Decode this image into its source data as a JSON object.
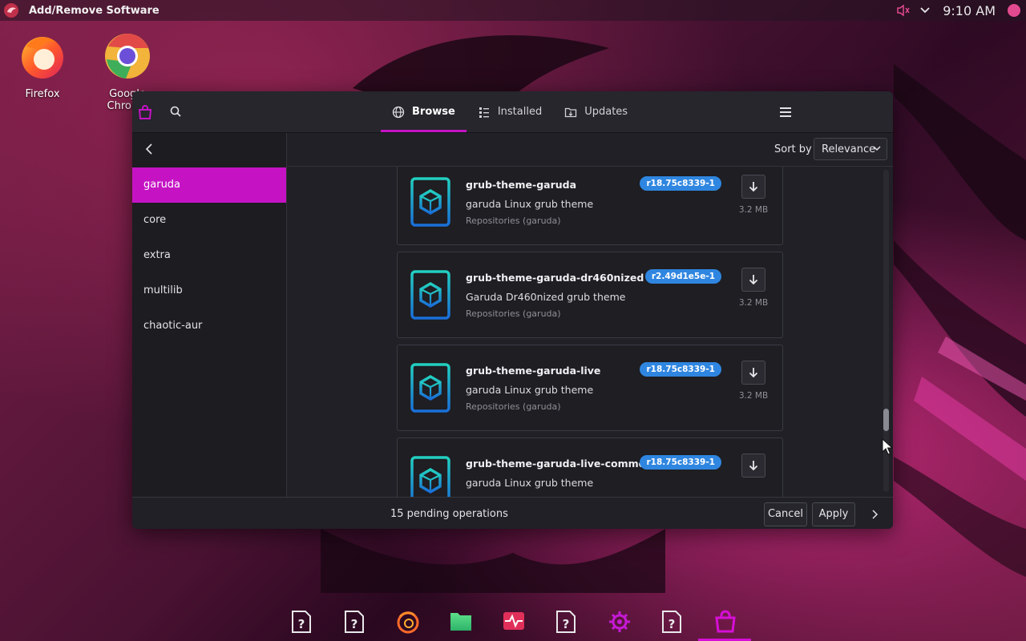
{
  "topbar": {
    "app_title": "Add/Remove Software",
    "clock": "9:10 AM",
    "icons": [
      "garuda-logo-icon",
      "speaker-muted-icon",
      "chevron-down-icon",
      "notification-dot-icon"
    ]
  },
  "desktop": {
    "icons": [
      {
        "label": "Firefox",
        "icon": "firefox-icon"
      },
      {
        "label": "Google Chrome",
        "icon": "chrome-icon"
      }
    ]
  },
  "window": {
    "tabs": [
      {
        "label": "Browse",
        "icon": "globe-icon",
        "active": true
      },
      {
        "label": "Installed",
        "icon": "list-icon",
        "active": false
      },
      {
        "label": "Updates",
        "icon": "folder-update-icon",
        "active": false
      }
    ],
    "sidebar": {
      "items": [
        {
          "label": "garuda",
          "active": true
        },
        {
          "label": "core",
          "active": false
        },
        {
          "label": "extra",
          "active": false
        },
        {
          "label": "multilib",
          "active": false
        },
        {
          "label": "chaotic-aur",
          "active": false
        }
      ]
    },
    "sort": {
      "label": "Sort by",
      "value": "Relevance"
    },
    "packages": [
      {
        "name": "grub-theme-garuda",
        "version": "r18.75c8339-1",
        "description": "garuda Linux grub theme",
        "repo": "Repositories (garuda)",
        "size": "3.2 MB"
      },
      {
        "name": "grub-theme-garuda-dr460nized",
        "version": "r2.49d1e5e-1",
        "description": "Garuda Dr460nized grub theme",
        "repo": "Repositories (garuda)",
        "size": "3.2 MB"
      },
      {
        "name": "grub-theme-garuda-live",
        "version": "r18.75c8339-1",
        "description": "garuda Linux grub theme",
        "repo": "Repositories (garuda)",
        "size": "3.2 MB"
      },
      {
        "name": "grub-theme-garuda-live-common",
        "version": "r18.75c8339-1",
        "description": "garuda Linux grub theme",
        "repo": "",
        "size": ""
      }
    ],
    "bottom": {
      "pending": "15 pending operations",
      "cancel_label": "Cancel",
      "apply_label": "Apply"
    }
  },
  "dock": {
    "items": [
      "unknown-app-icon",
      "unknown-app-icon",
      "firefox-icon",
      "files-icon",
      "system-monitor-icon",
      "unknown-app-icon",
      "settings-gear-icon",
      "unknown-app-icon",
      "software-store-icon"
    ],
    "active_index": 8
  },
  "colors": {
    "accent": "#c513c4",
    "version_badge": "#2f86e0",
    "window_bg": "#202026"
  }
}
